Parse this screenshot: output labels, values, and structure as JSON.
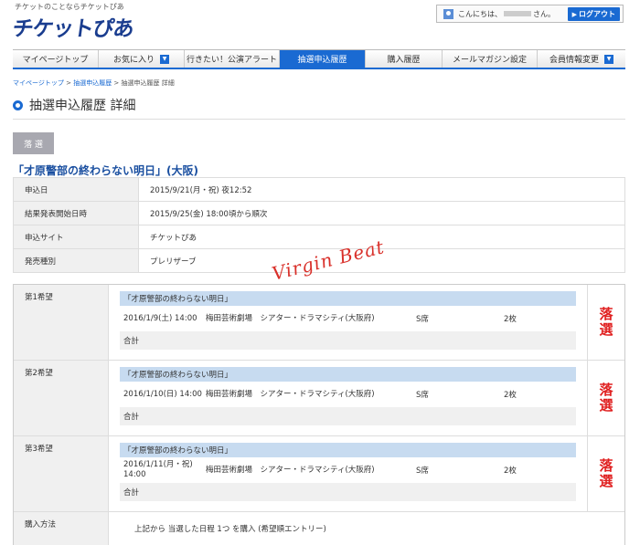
{
  "header": {
    "tagline": "チケットのことならチケットぴあ",
    "logo": "チケットぴあ",
    "greeting_prefix": "こんにちは、",
    "greeting_suffix": "さん。",
    "logout": "ログアウト"
  },
  "nav": {
    "tabs": [
      {
        "label": "マイページトップ"
      },
      {
        "label": "お気に入り"
      },
      {
        "label": "行きたい！公演アラート"
      },
      {
        "label": "抽選申込履歴"
      },
      {
        "label": "購入履歴"
      },
      {
        "label": "メールマガジン設定"
      },
      {
        "label": "会員情報変更"
      }
    ]
  },
  "breadcrumb": {
    "items": [
      "マイページトップ",
      "抽選申込履歴",
      "抽選申込履歴 詳細"
    ],
    "separator": " > "
  },
  "page_title": "抽選申込履歴 詳細",
  "status": "落 選",
  "event_title": "「才原警部の終わらない明日」(大阪)",
  "info": [
    {
      "label": "申込日",
      "value": "2015/9/21(月・祝) 夜12:52"
    },
    {
      "label": "結果発表開始日時",
      "value": "2015/9/25(金) 18:00頃から順次"
    },
    {
      "label": "申込サイト",
      "value": "チケットぴあ"
    },
    {
      "label": "発売種別",
      "value": "プレリザーブ"
    }
  ],
  "wishes": [
    {
      "label": "第1希望",
      "name": "「才原警部の終わらない明日」",
      "date": "2016/1/9(土) 14:00",
      "venue": "梅田芸術劇場　シアター・ドラマシティ(大阪府)",
      "seat": "S席",
      "qty": "2枚",
      "total": "合計",
      "result": "落選"
    },
    {
      "label": "第2希望",
      "name": "「才原警部の終わらない明日」",
      "date": "2016/1/10(日) 14:00",
      "venue": "梅田芸術劇場　シアター・ドラマシティ(大阪府)",
      "seat": "S席",
      "qty": "2枚",
      "total": "合計",
      "result": "落選"
    },
    {
      "label": "第3希望",
      "name": "「才原警部の終わらない明日」",
      "date": "2016/1/11(月・祝) 14:00",
      "venue": "梅田芸術劇場　シアター・ドラマシティ(大阪府)",
      "seat": "S席",
      "qty": "2枚",
      "total": "合計",
      "result": "落選"
    }
  ],
  "purchase": {
    "label": "購入方法",
    "value": "上記から 当選した日程 1つ を購入 (希望順エントリー)"
  },
  "signature": "Virgin Beat",
  "colors": {
    "accent": "#1a6ad2",
    "result_red": "#e02020"
  }
}
